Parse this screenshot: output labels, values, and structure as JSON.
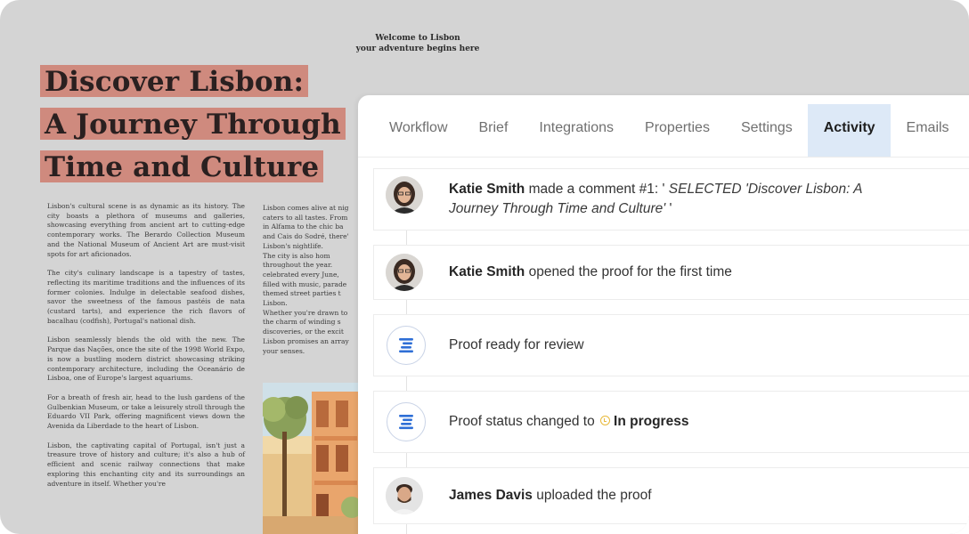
{
  "document": {
    "header": {
      "line1": "Welcome to Lisbon",
      "line2": "your adventure begins here"
    },
    "title": [
      "Discover Lisbon:",
      "A Journey Through",
      "Time and Culture"
    ],
    "left_column": [
      "Lisbon's cultural scene is as dynamic as its history. The city boasts a plethora of museums and galleries, showcasing everything from ancient art to cutting-edge contemporary works. The Berardo Collection Museum and the National Museum of Ancient Art are must-visit spots for art aficionados.",
      "The city's culinary landscape is a tapestry of tastes, reflecting its maritime traditions and the influences of its former colonies. Indulge in delectable seafood dishes, savor the sweetness of the famous pastéis de nata (custard tarts), and experience the rich flavors of bacalhau (codfish), Portugal's national dish.",
      "Lisbon seamlessly blends the old with the new. The Parque das Nações, once the site of the 1998 World Expo, is now a bustling modern district showcasing striking contemporary architecture, including the Oceanário de Lisboa, one of Europe's largest aquariums.",
      "For a breath of fresh air, head to the lush gardens of the Gulbenkian Museum, or take a leisurely stroll through the Eduardo VII Park, offering magnificent views down the Avenida da Liberdade to the heart of Lisbon.",
      "Lisbon, the captivating capital of Portugal, isn't just a treasure trove of history and culture; it's also a hub of efficient and scenic railway connections that make exploring this enchanting city and its surroundings an adventure in itself. Whether you're"
    ],
    "right_column": [
      "Lisbon comes alive at nig",
      "caters to all tastes. From",
      "in Alfama to the chic ba",
      "and Cais do Sodré, there'",
      "Lisbon's nightlife.",
      "The city is also hom",
      "throughout the year.",
      "celebrated every June,",
      "filled with music, parade",
      "themed street parties t",
      "Lisbon.",
      "Whether you're drawn to",
      "the charm of winding s",
      "discoveries, or the excit",
      "Lisbon promises an array",
      "your senses."
    ]
  },
  "tabs": [
    {
      "label": "Workflow",
      "active": false
    },
    {
      "label": "Brief",
      "active": false
    },
    {
      "label": "Integrations",
      "active": false
    },
    {
      "label": "Properties",
      "active": false
    },
    {
      "label": "Settings",
      "active": false
    },
    {
      "label": "Activity",
      "active": true
    },
    {
      "label": "Emails",
      "active": false
    }
  ],
  "activity": [
    {
      "actor": "Katie Smith",
      "action": "made a comment #1: '",
      "comment_line1": "SELECTED 'Discover Lisbon:  A",
      "comment_line2": "Journey Through Time and Culture'",
      "comment_end": " '"
    },
    {
      "actor": "Katie Smith",
      "action": "opened the proof for the first time"
    },
    {
      "text": "Proof ready for review"
    },
    {
      "text": "Proof status changed to",
      "status": "In progress"
    },
    {
      "actor": "James Davis",
      "action": "uploaded the proof"
    }
  ],
  "colors": {
    "accent_tab_bg": "#dde9f7",
    "title_highlight": "#cf8a7e",
    "status_in_progress": "#e8b93a",
    "proof_icon": "#2f6fd6"
  }
}
